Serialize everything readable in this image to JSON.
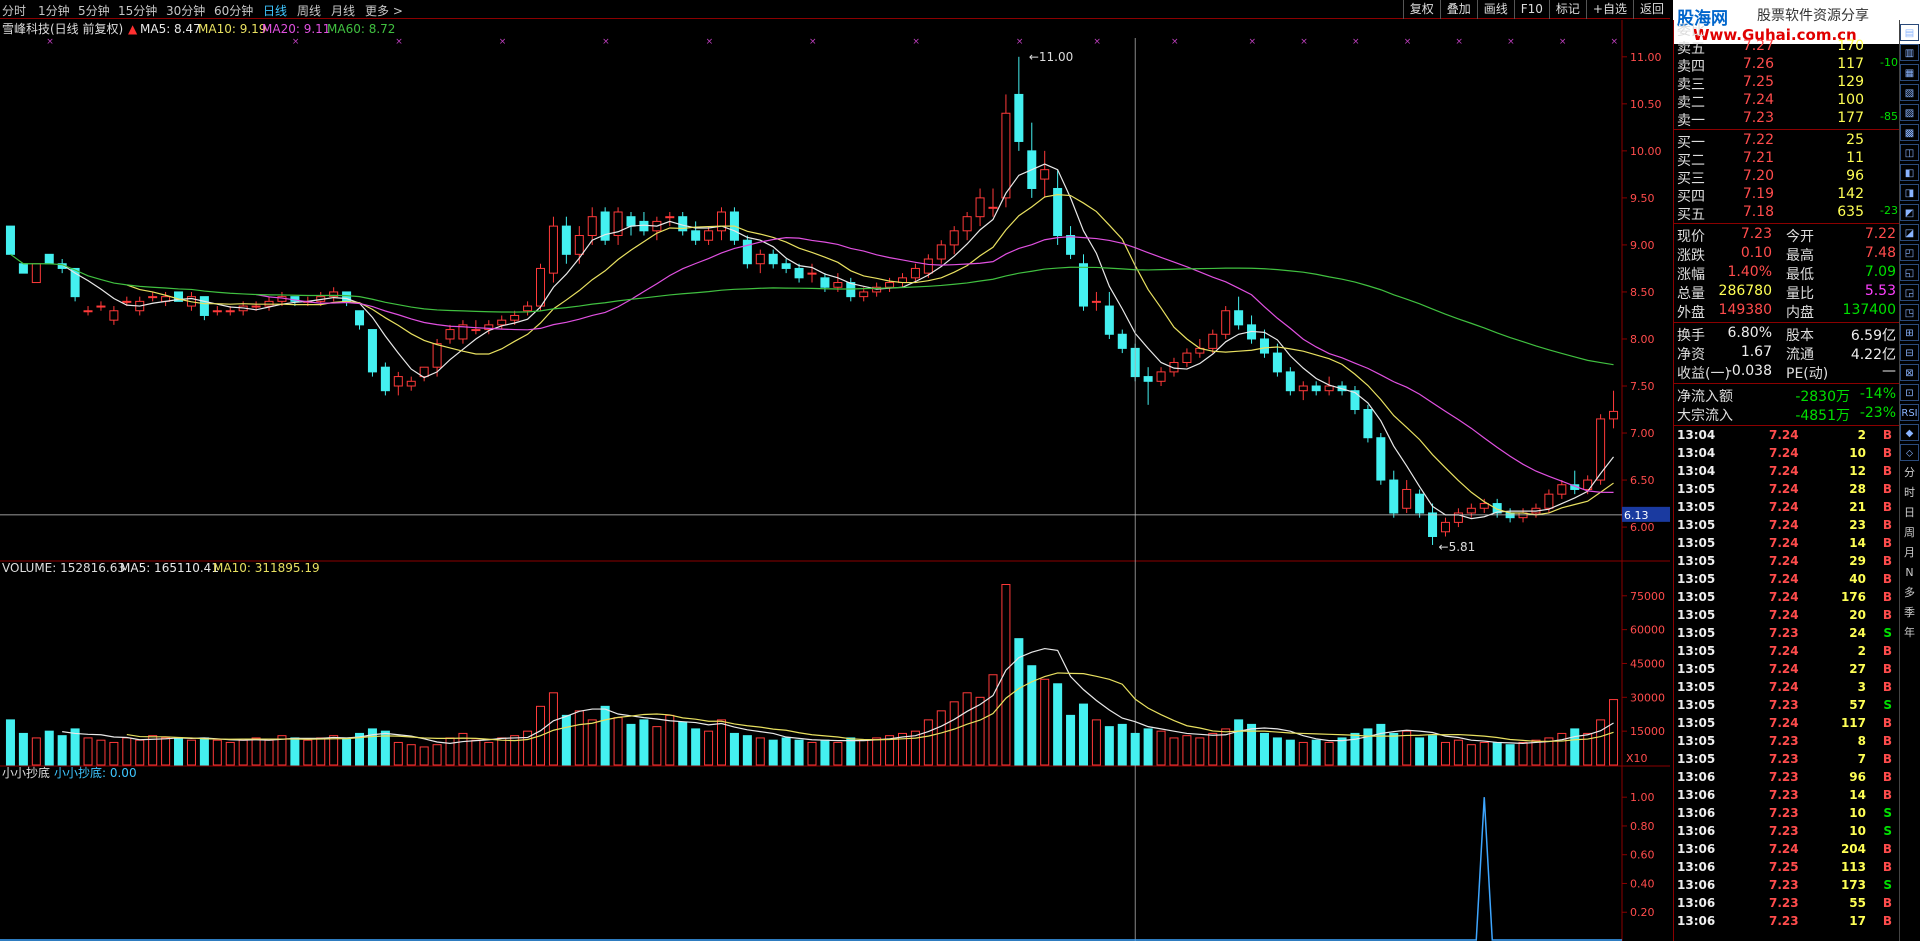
{
  "tabs": [
    "分时",
    "1分钟",
    "5分钟",
    "15分钟",
    "30分钟",
    "60分钟",
    "日线",
    "周线",
    "月线",
    "更多 >"
  ],
  "active_tab": "日线",
  "toolbar": [
    "复权",
    "叠加",
    "画线",
    "F10",
    "标记",
    "+自选",
    "返回"
  ],
  "logo": {
    "brand": "股海网",
    "slogan": "股票软件资源分享",
    "url": "Www.Guhai.com.cn"
  },
  "main_legend": {
    "stock": "雪峰科技(日线 前复权)",
    "ma5": "MA5: 8.47",
    "ma10": "MA10: 9.19",
    "ma20": "MA20: 9.11",
    "ma60": "MA60: 8.72"
  },
  "vol_legend": {
    "vol": "VOLUME: 152816.63",
    "ma5": "MA5: 165110.41",
    "ma10": "MA10: 311895.19"
  },
  "ind_legend": {
    "name": "小小抄底",
    "value": "小小抄底: 0.00"
  },
  "annotations": {
    "high": "11.00",
    "low": "5.81",
    "cursor_price": "6.13",
    "vol_unit": "X10"
  },
  "colors": {
    "up": "#ff3a3a",
    "down": "#44f0f0",
    "ma5": "#e8e8e8",
    "ma10": "#e8e060",
    "ma20": "#e050e0",
    "ma60": "#40c040",
    "axis": "#8b0000"
  },
  "chart_data": {
    "type": "candlestick",
    "price_axis": [
      6.0,
      6.5,
      7.0,
      7.5,
      8.0,
      8.5,
      9.0,
      9.5,
      10.0,
      10.5,
      11.0
    ],
    "vol_axis": [
      15000,
      30000,
      45000,
      60000,
      75000
    ],
    "ind_axis": [
      0.2,
      0.4,
      0.6,
      0.8,
      1.0
    ],
    "ohlc": [
      [
        9.2,
        9.2,
        8.9,
        8.9
      ],
      [
        8.8,
        8.8,
        8.7,
        8.7
      ],
      [
        8.6,
        8.8,
        8.6,
        8.8
      ],
      [
        8.9,
        8.9,
        8.8,
        8.8
      ],
      [
        8.8,
        8.85,
        8.7,
        8.75
      ],
      [
        8.75,
        8.75,
        8.4,
        8.45
      ],
      [
        8.3,
        8.35,
        8.25,
        8.3
      ],
      [
        8.35,
        8.4,
        8.3,
        8.35
      ],
      [
        8.2,
        8.35,
        8.15,
        8.3
      ],
      [
        8.4,
        8.45,
        8.35,
        8.4
      ],
      [
        8.3,
        8.45,
        8.25,
        8.4
      ],
      [
        8.45,
        8.5,
        8.4,
        8.45
      ],
      [
        8.4,
        8.5,
        8.35,
        8.45
      ],
      [
        8.5,
        8.5,
        8.4,
        8.4
      ],
      [
        8.35,
        8.5,
        8.3,
        8.45
      ],
      [
        8.45,
        8.45,
        8.2,
        8.25
      ],
      [
        8.3,
        8.35,
        8.25,
        8.3
      ],
      [
        8.3,
        8.35,
        8.25,
        8.3
      ],
      [
        8.3,
        8.4,
        8.25,
        8.35
      ],
      [
        8.35,
        8.4,
        8.3,
        8.35
      ],
      [
        8.35,
        8.45,
        8.3,
        8.4
      ],
      [
        8.4,
        8.5,
        8.35,
        8.45
      ],
      [
        8.45,
        8.45,
        8.35,
        8.4
      ],
      [
        8.4,
        8.45,
        8.35,
        8.4
      ],
      [
        8.4,
        8.5,
        8.35,
        8.45
      ],
      [
        8.45,
        8.55,
        8.4,
        8.5
      ],
      [
        8.5,
        8.5,
        8.35,
        8.4
      ],
      [
        8.3,
        8.3,
        8.1,
        8.15
      ],
      [
        8.1,
        8.1,
        7.6,
        7.65
      ],
      [
        7.7,
        7.75,
        7.4,
        7.45
      ],
      [
        7.5,
        7.65,
        7.4,
        7.6
      ],
      [
        7.5,
        7.6,
        7.45,
        7.55
      ],
      [
        7.6,
        7.7,
        7.55,
        7.7
      ],
      [
        7.7,
        8.0,
        7.6,
        7.95
      ],
      [
        8.0,
        8.15,
        7.95,
        8.1
      ],
      [
        8.0,
        8.2,
        7.95,
        8.15
      ],
      [
        8.1,
        8.2,
        8.05,
        8.1
      ],
      [
        8.1,
        8.2,
        8.05,
        8.15
      ],
      [
        8.15,
        8.25,
        8.1,
        8.2
      ],
      [
        8.2,
        8.3,
        8.15,
        8.25
      ],
      [
        8.3,
        8.4,
        8.25,
        8.35
      ],
      [
        8.35,
        8.8,
        8.3,
        8.75
      ],
      [
        8.7,
        9.3,
        8.6,
        9.2
      ],
      [
        9.2,
        9.3,
        8.8,
        8.9
      ],
      [
        8.9,
        9.2,
        8.8,
        9.1
      ],
      [
        9.1,
        9.4,
        9.0,
        9.3
      ],
      [
        9.35,
        9.4,
        9.0,
        9.05
      ],
      [
        9.1,
        9.4,
        9.0,
        9.35
      ],
      [
        9.3,
        9.35,
        9.1,
        9.2
      ],
      [
        9.25,
        9.35,
        9.1,
        9.15
      ],
      [
        9.15,
        9.3,
        9.05,
        9.25
      ],
      [
        9.3,
        9.35,
        9.2,
        9.3
      ],
      [
        9.3,
        9.35,
        9.1,
        9.15
      ],
      [
        9.15,
        9.25,
        9.0,
        9.05
      ],
      [
        9.05,
        9.2,
        9.0,
        9.15
      ],
      [
        9.15,
        9.4,
        9.05,
        9.35
      ],
      [
        9.35,
        9.4,
        9.0,
        9.05
      ],
      [
        9.05,
        9.1,
        8.75,
        8.8
      ],
      [
        8.8,
        8.95,
        8.7,
        8.9
      ],
      [
        8.9,
        8.95,
        8.75,
        8.8
      ],
      [
        8.8,
        8.85,
        8.7,
        8.75
      ],
      [
        8.75,
        8.8,
        8.6,
        8.65
      ],
      [
        8.7,
        8.8,
        8.6,
        8.7
      ],
      [
        8.65,
        8.7,
        8.5,
        8.55
      ],
      [
        8.55,
        8.7,
        8.5,
        8.6
      ],
      [
        8.6,
        8.65,
        8.4,
        8.45
      ],
      [
        8.45,
        8.55,
        8.4,
        8.5
      ],
      [
        8.5,
        8.6,
        8.45,
        8.55
      ],
      [
        8.55,
        8.65,
        8.5,
        8.6
      ],
      [
        8.6,
        8.7,
        8.55,
        8.65
      ],
      [
        8.65,
        8.8,
        8.6,
        8.75
      ],
      [
        8.7,
        8.9,
        8.65,
        8.85
      ],
      [
        8.85,
        9.05,
        8.8,
        9.0
      ],
      [
        9.0,
        9.2,
        8.9,
        9.15
      ],
      [
        9.15,
        9.35,
        9.05,
        9.3
      ],
      [
        9.3,
        9.6,
        9.2,
        9.5
      ],
      [
        9.4,
        9.6,
        9.3,
        9.4
      ],
      [
        9.5,
        10.6,
        9.4,
        10.4
      ],
      [
        10.6,
        11.0,
        10.0,
        10.1
      ],
      [
        10.0,
        10.3,
        9.5,
        9.6
      ],
      [
        9.7,
        10.0,
        9.5,
        9.8
      ],
      [
        9.6,
        9.8,
        9.0,
        9.1
      ],
      [
        9.1,
        9.2,
        8.85,
        8.9
      ],
      [
        8.8,
        8.9,
        8.3,
        8.35
      ],
      [
        8.4,
        8.5,
        8.3,
        8.4
      ],
      [
        8.35,
        8.5,
        8.0,
        8.05
      ],
      [
        8.05,
        8.1,
        7.85,
        7.9
      ],
      [
        7.9,
        7.95,
        7.55,
        7.6
      ],
      [
        7.6,
        7.7,
        7.3,
        7.55
      ],
      [
        7.55,
        7.7,
        7.5,
        7.65
      ],
      [
        7.65,
        7.8,
        7.6,
        7.75
      ],
      [
        7.75,
        7.9,
        7.7,
        7.85
      ],
      [
        7.85,
        8.0,
        7.8,
        7.9
      ],
      [
        7.9,
        8.1,
        7.85,
        8.05
      ],
      [
        8.05,
        8.35,
        8.0,
        8.3
      ],
      [
        8.3,
        8.45,
        8.1,
        8.15
      ],
      [
        8.15,
        8.25,
        7.95,
        8.0
      ],
      [
        8.0,
        8.1,
        7.8,
        7.85
      ],
      [
        7.85,
        7.95,
        7.6,
        7.65
      ],
      [
        7.65,
        7.7,
        7.4,
        7.45
      ],
      [
        7.45,
        7.55,
        7.35,
        7.5
      ],
      [
        7.5,
        7.55,
        7.4,
        7.45
      ],
      [
        7.45,
        7.6,
        7.4,
        7.5
      ],
      [
        7.5,
        7.55,
        7.4,
        7.45
      ],
      [
        7.45,
        7.5,
        7.2,
        7.25
      ],
      [
        7.25,
        7.3,
        6.9,
        6.95
      ],
      [
        6.95,
        7.0,
        6.45,
        6.5
      ],
      [
        6.5,
        6.6,
        6.1,
        6.15
      ],
      [
        6.2,
        6.5,
        6.15,
        6.4
      ],
      [
        6.35,
        6.4,
        6.1,
        6.15
      ],
      [
        6.15,
        6.25,
        5.81,
        5.9
      ],
      [
        5.95,
        6.1,
        5.9,
        6.05
      ],
      [
        6.05,
        6.2,
        6.0,
        6.15
      ],
      [
        6.15,
        6.25,
        6.1,
        6.2
      ],
      [
        6.2,
        6.3,
        6.15,
        6.25
      ],
      [
        6.25,
        6.3,
        6.1,
        6.15
      ],
      [
        6.15,
        6.2,
        6.05,
        6.1
      ],
      [
        6.1,
        6.2,
        6.05,
        6.15
      ],
      [
        6.15,
        6.25,
        6.1,
        6.2
      ],
      [
        6.2,
        6.4,
        6.15,
        6.35
      ],
      [
        6.35,
        6.5,
        6.3,
        6.45
      ],
      [
        6.45,
        6.6,
        6.35,
        6.4
      ],
      [
        6.4,
        6.55,
        6.35,
        6.5
      ],
      [
        6.5,
        7.2,
        6.45,
        7.15
      ],
      [
        7.15,
        7.45,
        7.05,
        7.23
      ]
    ],
    "volume": [
      20000,
      14000,
      12000,
      15000,
      13000,
      16000,
      12000,
      11000,
      10000,
      12000,
      11000,
      13000,
      12000,
      12000,
      11000,
      12000,
      11000,
      10000,
      11000,
      12000,
      11000,
      13000,
      12000,
      11000,
      12000,
      13000,
      12000,
      14000,
      16000,
      15000,
      10000,
      9000,
      8000,
      9000,
      12000,
      14000,
      11000,
      10000,
      12000,
      13000,
      15000,
      26000,
      32000,
      22000,
      24000,
      20000,
      26000,
      21000,
      18000,
      20000,
      17000,
      22000,
      19000,
      16000,
      15000,
      20000,
      14000,
      13000,
      12000,
      11000,
      12000,
      11000,
      10000,
      11000,
      10000,
      12000,
      11000,
      12000,
      13000,
      14000,
      15000,
      20000,
      24000,
      28000,
      32000,
      30000,
      40000,
      80000,
      56000,
      44000,
      38000,
      36000,
      22000,
      27000,
      20000,
      17000,
      18000,
      14000,
      16000,
      15000,
      12000,
      13000,
      12000,
      14000,
      16000,
      20000,
      18000,
      14000,
      12000,
      11000,
      10000,
      11000,
      10000,
      12000,
      14000,
      16000,
      18000,
      14000,
      15000,
      12000,
      13000,
      10000,
      11000,
      9000,
      10000,
      10000,
      9000,
      10000,
      11000,
      12000,
      14000,
      16000,
      14000,
      20000,
      29000
    ],
    "indicator_peak_index": 114
  },
  "quote": {
    "asks": [
      [
        "委比",
        "",
        "",
        ""
      ],
      [
        "卖五",
        "7.27",
        "170",
        ""
      ],
      [
        "卖四",
        "7.26",
        "117",
        "-10"
      ],
      [
        "卖三",
        "7.25",
        "129",
        ""
      ],
      [
        "卖二",
        "7.24",
        "100",
        ""
      ],
      [
        "卖一",
        "7.23",
        "177",
        "-85"
      ]
    ],
    "bids": [
      [
        "买一",
        "7.22",
        "25",
        ""
      ],
      [
        "买二",
        "7.21",
        "11",
        ""
      ],
      [
        "买三",
        "7.20",
        "96",
        ""
      ],
      [
        "买四",
        "7.19",
        "142",
        ""
      ],
      [
        "买五",
        "7.18",
        "635",
        "-23"
      ]
    ],
    "info": [
      [
        "现价",
        "7.23",
        "今开",
        "7.22"
      ],
      [
        "涨跌",
        "0.10",
        "最高",
        "7.48"
      ],
      [
        "涨幅",
        "1.40%",
        "最低",
        "7.09"
      ],
      [
        "总量",
        "286780",
        "量比",
        "5.53"
      ],
      [
        "外盘",
        "149380",
        "内盘",
        "137400"
      ]
    ],
    "info2": [
      [
        "换手",
        "6.80%",
        "股本",
        "6.59亿"
      ],
      [
        "净资",
        "1.67",
        "流通",
        "4.22亿"
      ],
      [
        "收益(一)",
        "-0.038",
        "PE(动)",
        "—"
      ]
    ],
    "flow": [
      [
        "净流入额",
        "-2830万",
        "-14%"
      ],
      [
        "大宗流入",
        "-4851万",
        "-23%"
      ]
    ],
    "ticks": [
      [
        "13:04",
        "7.24",
        "2",
        "B"
      ],
      [
        "13:04",
        "7.24",
        "10",
        "B"
      ],
      [
        "13:04",
        "7.24",
        "12",
        "B"
      ],
      [
        "13:05",
        "7.24",
        "28",
        "B"
      ],
      [
        "13:05",
        "7.24",
        "21",
        "B"
      ],
      [
        "13:05",
        "7.24",
        "23",
        "B"
      ],
      [
        "13:05",
        "7.24",
        "14",
        "B"
      ],
      [
        "13:05",
        "7.24",
        "29",
        "B"
      ],
      [
        "13:05",
        "7.24",
        "40",
        "B"
      ],
      [
        "13:05",
        "7.24",
        "176",
        "B"
      ],
      [
        "13:05",
        "7.24",
        "20",
        "B"
      ],
      [
        "13:05",
        "7.23",
        "24",
        "S"
      ],
      [
        "13:05",
        "7.24",
        "2",
        "B"
      ],
      [
        "13:05",
        "7.24",
        "27",
        "B"
      ],
      [
        "13:05",
        "7.24",
        "3",
        "B"
      ],
      [
        "13:05",
        "7.23",
        "57",
        "S"
      ],
      [
        "13:05",
        "7.24",
        "117",
        "B"
      ],
      [
        "13:05",
        "7.23",
        "8",
        "B"
      ],
      [
        "13:05",
        "7.23",
        "7",
        "B"
      ],
      [
        "13:06",
        "7.23",
        "96",
        "B"
      ],
      [
        "13:06",
        "7.23",
        "14",
        "B"
      ],
      [
        "13:06",
        "7.23",
        "10",
        "S"
      ],
      [
        "13:06",
        "7.23",
        "10",
        "S"
      ],
      [
        "13:06",
        "7.24",
        "204",
        "B"
      ],
      [
        "13:06",
        "7.25",
        "113",
        "B"
      ],
      [
        "13:06",
        "7.23",
        "173",
        "S"
      ],
      [
        "13:06",
        "7.23",
        "55",
        "B"
      ],
      [
        "13:06",
        "7.23",
        "17",
        "B"
      ]
    ]
  },
  "side_icons": [
    "分",
    "时",
    "日",
    "周",
    "月",
    "N",
    "多",
    "季",
    "年"
  ]
}
